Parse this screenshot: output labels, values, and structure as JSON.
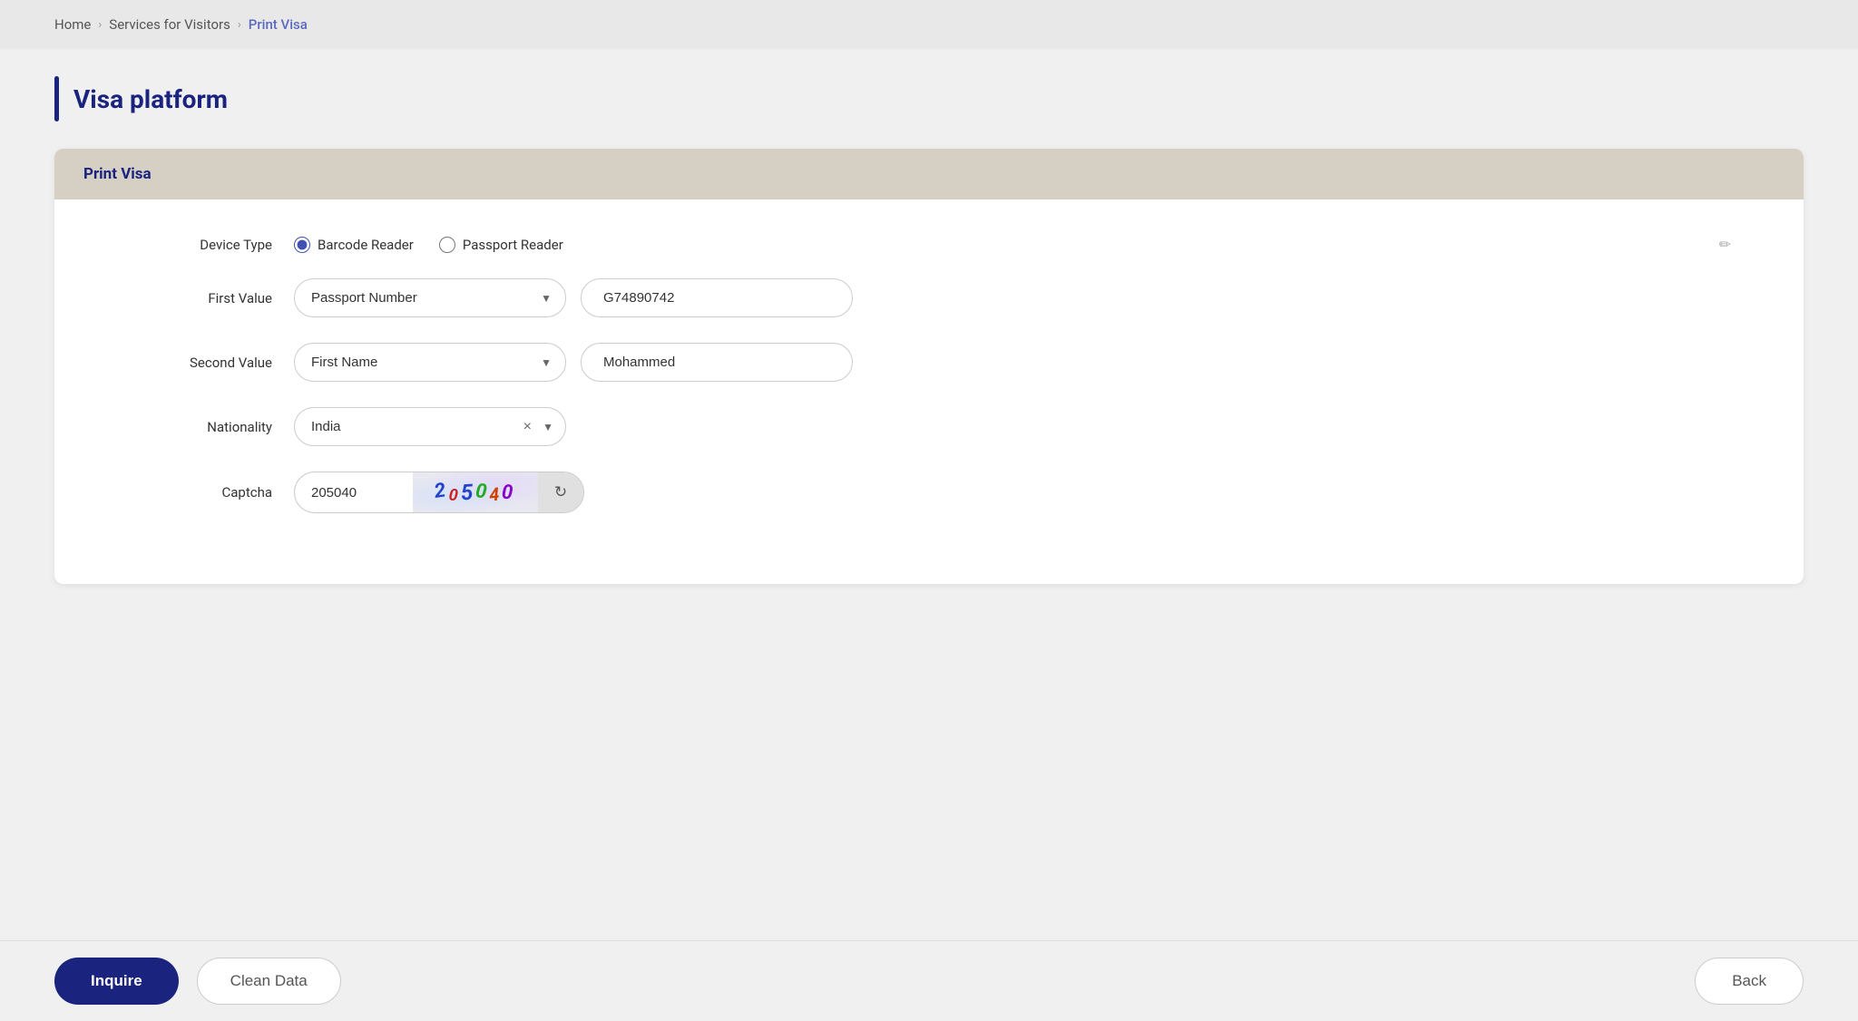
{
  "breadcrumb": {
    "home": "Home",
    "services": "Services for Visitors",
    "current": "Print Visa",
    "sep": ">"
  },
  "page": {
    "title": "Visa platform"
  },
  "card": {
    "header": "Print Visa"
  },
  "form": {
    "device_type_label": "Device Type",
    "device_options": [
      {
        "id": "barcode",
        "label": "Barcode Reader",
        "checked": true
      },
      {
        "id": "passport",
        "label": "Passport Reader",
        "checked": false
      }
    ],
    "first_value_label": "First Value",
    "first_value_select": "Passport Number",
    "first_value_input": "G74890742",
    "second_value_label": "Second Value",
    "second_value_select": "First Name",
    "second_value_input": "Mohammed",
    "nationality_label": "Nationality",
    "nationality_value": "India",
    "captcha_label": "Captcha",
    "captcha_input": "205040",
    "captcha_chars": [
      "2",
      "0",
      "5",
      "0",
      "4",
      "0"
    ]
  },
  "buttons": {
    "inquire": "Inquire",
    "clean_data": "Clean Data",
    "back": "Back"
  }
}
